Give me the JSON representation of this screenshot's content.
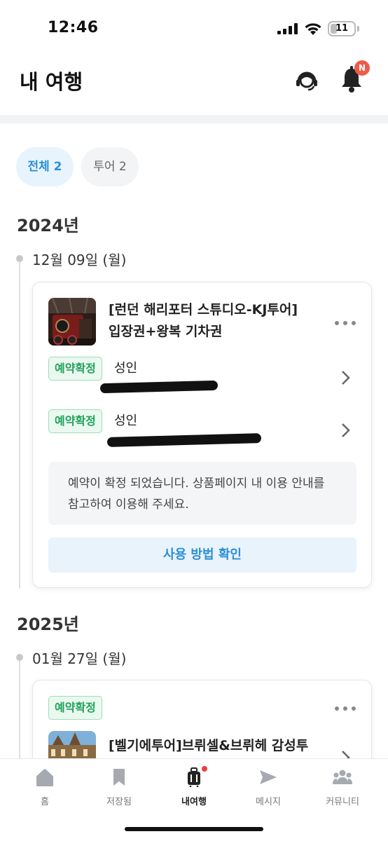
{
  "status_bar": {
    "time": "12:46",
    "battery": "11"
  },
  "header": {
    "title": "내 여행",
    "notification_badge": "N"
  },
  "filters": [
    {
      "label": "전체 2",
      "active": true
    },
    {
      "label": "투어 2",
      "active": false
    }
  ],
  "groups": [
    {
      "year": "2024년",
      "date": "12월 09일 (월)",
      "booking": {
        "title_line1": "[런던 해리포터 스튜디오-KJ투어]",
        "title_line2": "입장권+왕복 기차권",
        "tickets": [
          {
            "status": "예약확정",
            "type": "성인"
          },
          {
            "status": "예약확정",
            "type": "성인"
          }
        ],
        "notice_line1": "예약이 확정 되었습니다. 상품페이지 내 이용 안내를",
        "notice_line2": "참고하여 이용해 주세요.",
        "action_label": "사용 방법 확인"
      }
    },
    {
      "year": "2025년",
      "date": "01월 27일 (월)",
      "booking": {
        "status": "예약확정",
        "title_line1": "[벨기에투어]브뤼셀&브뤼헤 감성투"
      }
    }
  ],
  "bottom_nav": [
    {
      "label": "홈",
      "icon": "home-icon"
    },
    {
      "label": "저장됨",
      "icon": "bookmark-icon"
    },
    {
      "label": "내여행",
      "icon": "luggage-icon",
      "active": true
    },
    {
      "label": "메시지",
      "icon": "send-icon"
    },
    {
      "label": "커뮤니티",
      "icon": "community-icon"
    }
  ],
  "colors": {
    "accent": "#2d8fd5",
    "confirmed": "#20a15a",
    "badge": "#ef5a4a"
  }
}
